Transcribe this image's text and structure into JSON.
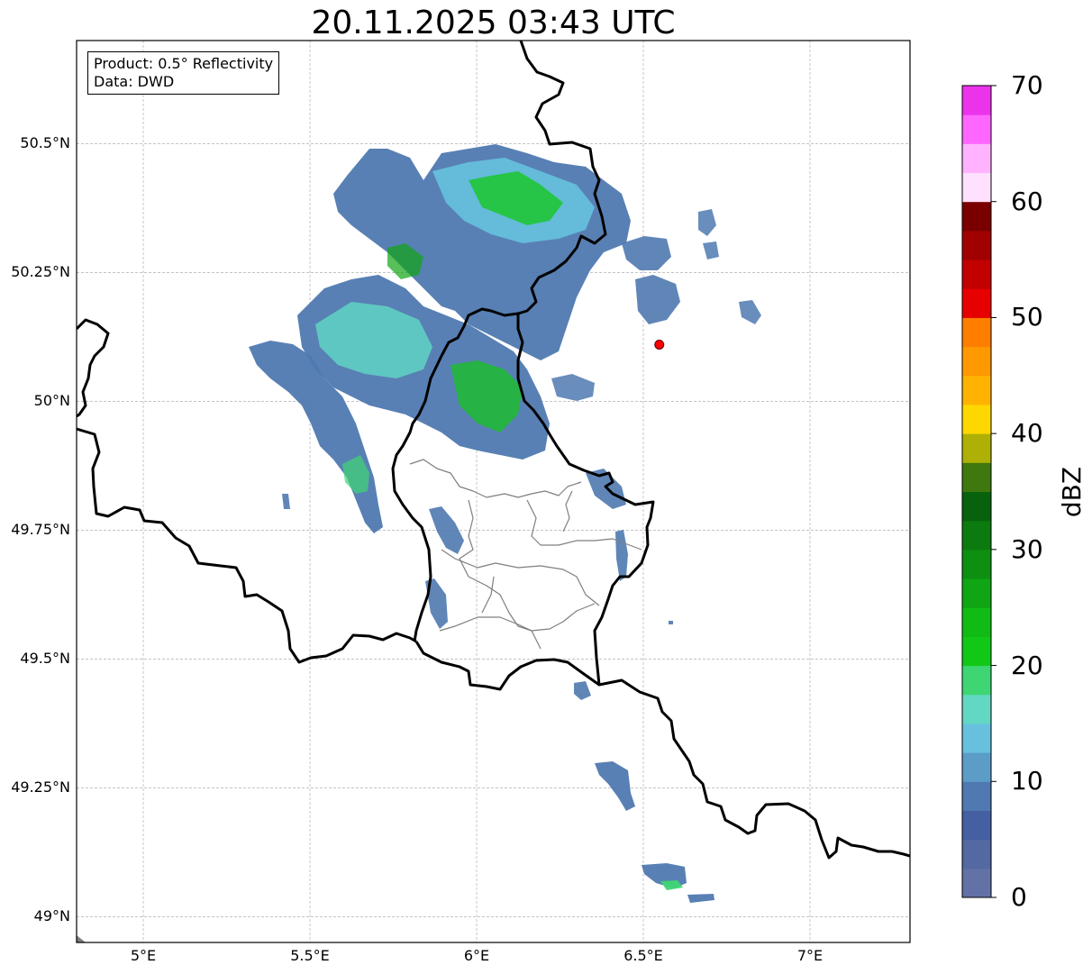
{
  "title": "20.11.2025 03:43 UTC",
  "info": {
    "product": "Product: 0.5° Reflectivity",
    "data": "Data: DWD"
  },
  "map": {
    "lon_range": [
      4.8,
      7.3
    ],
    "lat_range": [
      48.95,
      50.7
    ],
    "gridlines": true,
    "lon_ticks": [
      {
        "value": 5.0,
        "label": "5°E"
      },
      {
        "value": 5.5,
        "label": "5.5°E"
      },
      {
        "value": 6.0,
        "label": "6°E"
      },
      {
        "value": 6.5,
        "label": "6.5°E"
      },
      {
        "value": 7.0,
        "label": "7°E"
      }
    ],
    "lat_ticks": [
      {
        "value": 50.5,
        "label": "50.5°N"
      },
      {
        "value": 50.25,
        "label": "50.25°N"
      },
      {
        "value": 50.0,
        "label": "50°N"
      },
      {
        "value": 49.75,
        "label": "49.75°N"
      },
      {
        "value": 49.5,
        "label": "49.5°N"
      },
      {
        "value": 49.25,
        "label": "49.25°N"
      },
      {
        "value": 49.0,
        "label": "49°N"
      }
    ],
    "radar_site": {
      "lon": 6.548,
      "lat": 50.11,
      "color": "#ff0000"
    }
  },
  "colorbar": {
    "unit": "dBZ",
    "min": 0,
    "max": 70,
    "step": 2.5,
    "tick_labels": [
      "0",
      "10",
      "20",
      "30",
      "40",
      "50",
      "60",
      "70"
    ],
    "colors": [
      "#6272a6",
      "#5468a1",
      "#4560a2",
      "#4f79b0",
      "#5b9dc7",
      "#67c1de",
      "#62d8c4",
      "#3ed673",
      "#12c816",
      "#10bb14",
      "#0fa513",
      "#0d8f11",
      "#0b7a0f",
      "#08610d",
      "#3e780e",
      "#afb005",
      "#ffd700",
      "#ffb300",
      "#ff9900",
      "#ff7e00",
      "#e60000",
      "#c20000",
      "#a00000",
      "#7a0000",
      "#ffe0ff",
      "#ffb3ff",
      "#ff66ff",
      "#eb33eb"
    ]
  }
}
